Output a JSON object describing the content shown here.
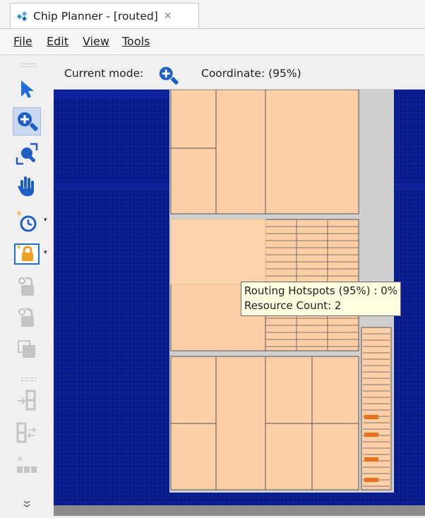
{
  "tab": {
    "title": "Chip Planner  - [routed]",
    "close_glyph": "✕",
    "icon": "chip-planner-icon"
  },
  "menu": {
    "items": [
      {
        "label": "File"
      },
      {
        "label": "Edit"
      },
      {
        "label": "View"
      },
      {
        "label": "Tools"
      }
    ]
  },
  "status": {
    "mode_label": "Current mode:",
    "mode_icon": "zoom-in-icon",
    "coordinate": "Coordinate: (95%)"
  },
  "toolbar": {
    "tools": [
      {
        "name": "selection-tool",
        "icon": "pointer-arrow-icon",
        "active": false
      },
      {
        "name": "zoom-tool",
        "icon": "zoom-in-icon",
        "active": true
      },
      {
        "name": "fit-in-window-tool",
        "icon": "zoom-fit-icon",
        "active": false
      },
      {
        "name": "hand-tool",
        "icon": "hand-icon",
        "active": false
      },
      {
        "name": "history-tool",
        "icon": "clock-star-icon",
        "active": false
      },
      {
        "name": "lock-region-tool",
        "icon": "lock-star-icon",
        "active": false
      },
      {
        "name": "add-region-tool",
        "icon": "lock-add-icon",
        "active": false
      },
      {
        "name": "remove-region-tool",
        "icon": "lock-remove-icon",
        "active": false
      },
      {
        "name": "copy-region-tool",
        "icon": "copy-region-icon",
        "active": false
      },
      {
        "name": "move-in-tool",
        "icon": "move-in-icon",
        "active": false
      },
      {
        "name": "swap-tool",
        "icon": "swap-icon",
        "active": false
      },
      {
        "name": "new-region-tool",
        "icon": "region-star-icon",
        "active": false
      },
      {
        "name": "more-tools",
        "icon": "double-chevron-down-icon",
        "active": false
      }
    ]
  },
  "tooltip": {
    "line1": "Routing Hotspots (95%) : 0%",
    "line2": "Resource Count: 2"
  },
  "colors": {
    "canvas_background": "#0a1a7e",
    "grid_cell": "#0b1f99",
    "region_fill": "#fdcfa7",
    "region_border": "#555555",
    "frame_gray": "#cfcfcf",
    "hot_orange": "#e8711f",
    "accent_blue": "#1f6fd6"
  }
}
